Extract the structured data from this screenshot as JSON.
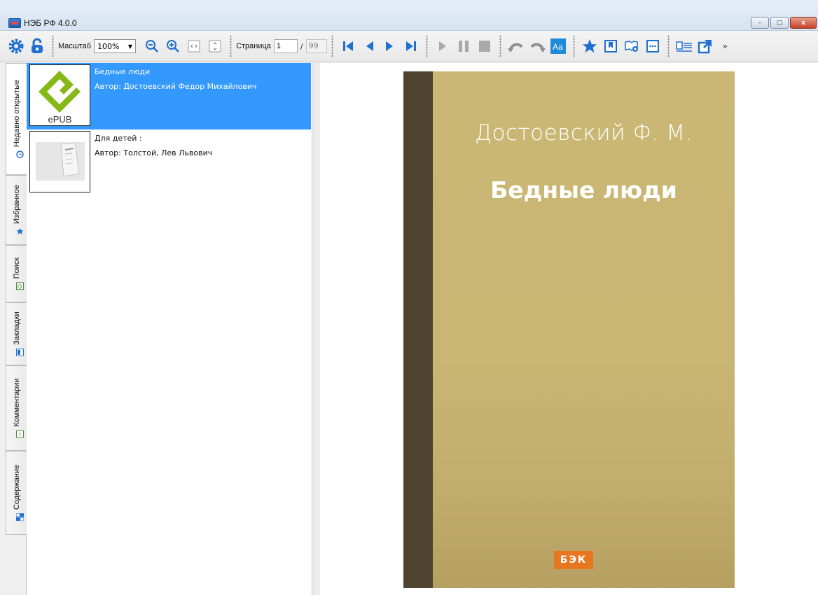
{
  "window": {
    "title": "НЭБ РФ 4.0.0",
    "buttons": {
      "minimize": "–",
      "maximize": "□",
      "close": "x"
    }
  },
  "toolbar": {
    "zoom_label": "Масштаб",
    "zoom_value": "100%",
    "page_label": "Страница",
    "page_current": "1",
    "page_separator": "/",
    "page_total": "99",
    "overflow": "»"
  },
  "tabs": [
    {
      "label": "Недавно открытые",
      "icon": "clock-icon",
      "active": true
    },
    {
      "label": "Избранное",
      "icon": "star-icon",
      "active": false
    },
    {
      "label": "Поиск",
      "icon": "search-icon",
      "active": false
    },
    {
      "label": "Закладки",
      "icon": "bookmark-icon",
      "active": false
    },
    {
      "label": "Комментарии",
      "icon": "comment-icon",
      "active": false
    },
    {
      "label": "Содержание",
      "icon": "contents-icon",
      "active": false
    }
  ],
  "books": [
    {
      "title": "Бедные люди",
      "author": "Автор: Достоевский Федор Михайлович",
      "thumb_label": "ePUB",
      "selected": true
    },
    {
      "title": "Для детей :",
      "author": "Автор: Толстой, Лев Львович",
      "selected": false
    }
  ],
  "cover": {
    "author": "Достоевский Ф. М.",
    "title": "Бедные люди",
    "badge": "БЭК",
    "colors": {
      "background": "#c9b673",
      "spine": "#4e4430",
      "badge": "#e8761e"
    }
  },
  "colors": {
    "selection": "#3399ff",
    "accent_blue": "#1f6fd0"
  }
}
